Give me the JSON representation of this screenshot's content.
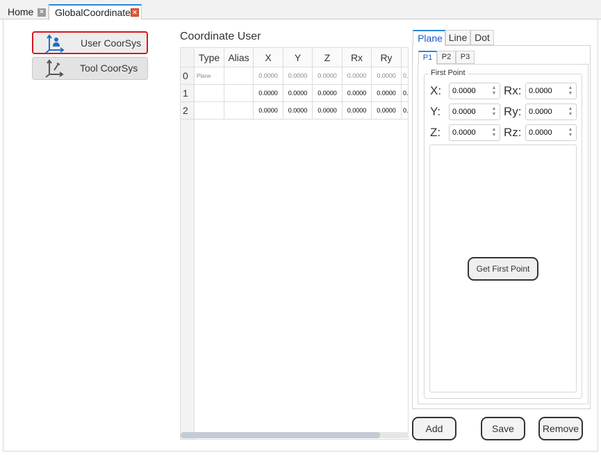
{
  "tabs": [
    {
      "label": "Home",
      "close": "×"
    },
    {
      "label": "GlobalCoordinate",
      "close": "×"
    }
  ],
  "left": {
    "user_btn": "User CoorSys",
    "tool_btn": "Tool CoorSys",
    "icons": [
      "user-coordinate-icon",
      "tool-coordinate-icon"
    ],
    "accent": "#d8161c"
  },
  "table": {
    "title": "Coordinate User",
    "columns": [
      "Type",
      "Alias",
      "X",
      "Y",
      "Z",
      "Rx",
      "Ry"
    ],
    "rows": [
      {
        "index": "0",
        "type": "Plane",
        "alias": "",
        "values": [
          "0.0000",
          "0.0000",
          "0.0000",
          "0.0000",
          "0.0000"
        ],
        "overflow": "0."
      },
      {
        "index": "1",
        "type": "",
        "alias": "",
        "values": [
          "0.0000",
          "0.0000",
          "0.0000",
          "0.0000",
          "0.0000"
        ],
        "overflow": "0."
      },
      {
        "index": "2",
        "type": "",
        "alias": "",
        "values": [
          "0.0000",
          "0.0000",
          "0.0000",
          "0.0000",
          "0.0000"
        ],
        "overflow": "0."
      }
    ]
  },
  "right": {
    "tabs": [
      "Plane",
      "Line",
      "Dot"
    ],
    "point_tabs": [
      "P1",
      "P2",
      "P3"
    ],
    "group_title": "First Point",
    "fields": {
      "x": {
        "label": "X:",
        "value": "0.0000"
      },
      "y": {
        "label": "Y:",
        "value": "0.0000"
      },
      "z": {
        "label": "Z:",
        "value": "0.0000"
      },
      "rx": {
        "label": "Rx:",
        "value": "0.0000"
      },
      "ry": {
        "label": "Ry:",
        "value": "0.0000"
      },
      "rz": {
        "label": "Rz:",
        "value": "0.0000"
      }
    },
    "get_button": "Get First Point",
    "active_tab_color": "#1a55c9"
  },
  "actions": {
    "add": "Add",
    "save": "Save",
    "remove": "Remove"
  }
}
